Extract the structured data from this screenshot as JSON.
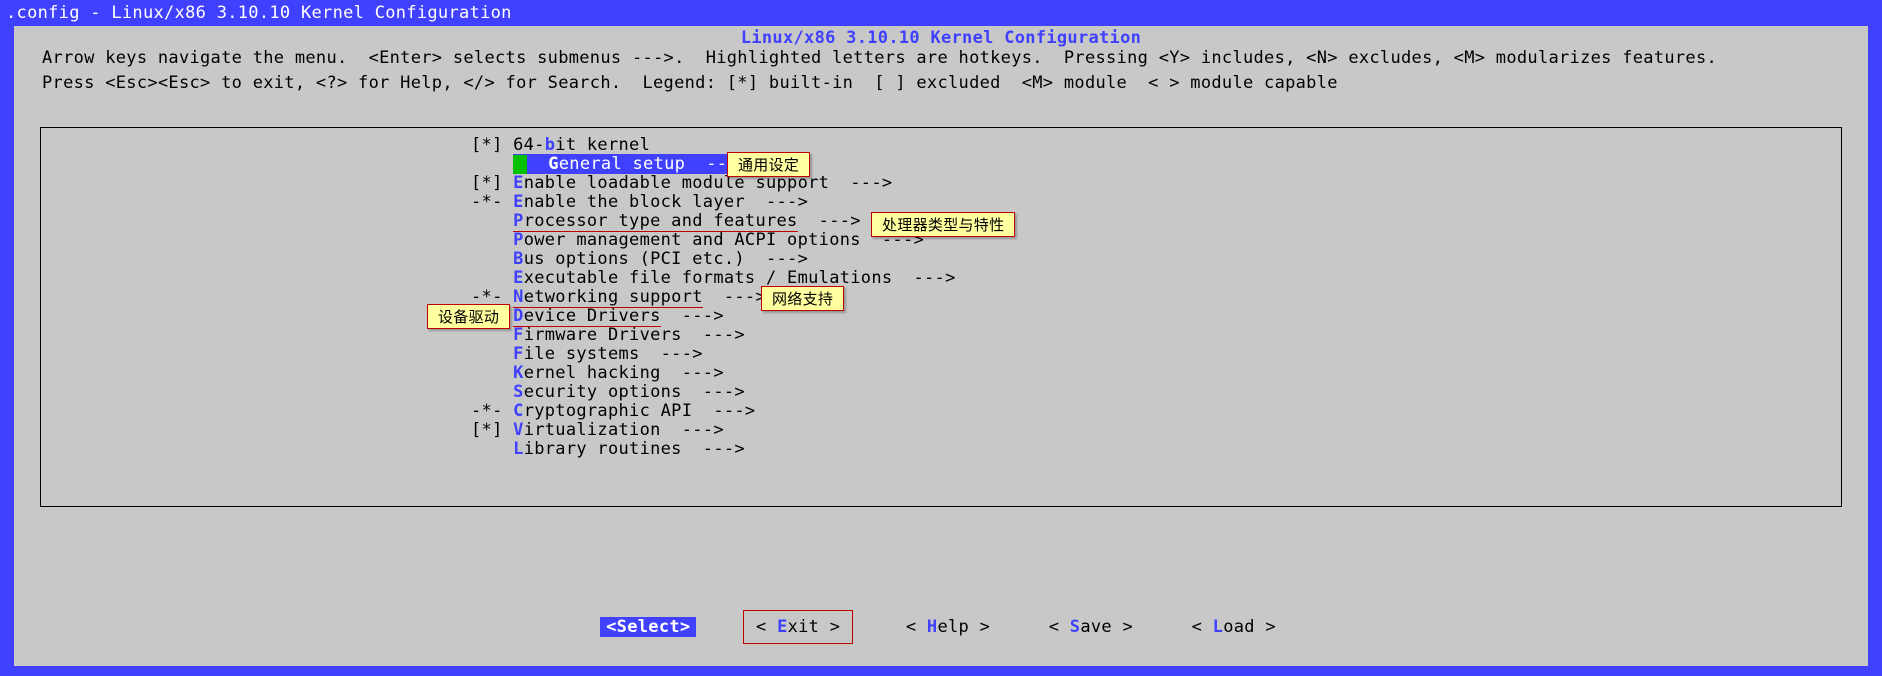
{
  "titlebar": ".config - Linux/x86 3.10.10 Kernel Configuration",
  "dialog_title": "Linux/x86 3.10.10 Kernel Configuration",
  "help_line1": "Arrow keys navigate the menu.  <Enter> selects submenus --->.  Highlighted letters are hotkeys.  Pressing <Y> includes, <N> excludes, <M> modularizes features.",
  "help_line2": "Press <Esc><Esc> to exit, <?> for Help, </> for Search.  Legend: [*] built-in  [ ] excluded  <M> module  < > module capable",
  "menu": {
    "items": [
      {
        "prefix": "[*] ",
        "pre": "64-",
        "hot": "b",
        "post": "it kernel"
      },
      {
        "prefix": "    ",
        "pre": "",
        "hot": "G",
        "post": "eneral setup  --->",
        "selected": true
      },
      {
        "prefix": "[*] ",
        "pre": "",
        "hot": "E",
        "post": "nable loadable module support  --->"
      },
      {
        "prefix": "-*- ",
        "pre": "",
        "hot": "E",
        "post": "nable the block layer  --->"
      },
      {
        "prefix": "    ",
        "pre": "",
        "hot": "P",
        "post": "rocessor type and features",
        "tail": "  --->",
        "underline": true
      },
      {
        "prefix": "    ",
        "pre": "",
        "hot": "P",
        "post": "ower management and ACPI options  --->"
      },
      {
        "prefix": "    ",
        "pre": "",
        "hot": "B",
        "post": "us options (PCI etc.)  --->"
      },
      {
        "prefix": "    ",
        "pre": "",
        "hot": "E",
        "post": "xecutable file formats / Emulations  --->"
      },
      {
        "prefix": "-*- ",
        "pre": "",
        "hot": "N",
        "post": "etworking support",
        "tail": "  --->",
        "underline": true
      },
      {
        "prefix": "    ",
        "pre": "",
        "hot": "D",
        "post": "evice Drivers",
        "tail": "  --->",
        "underline": true
      },
      {
        "prefix": "    ",
        "pre": "",
        "hot": "F",
        "post": "irmware Drivers  --->"
      },
      {
        "prefix": "    ",
        "pre": "",
        "hot": "F",
        "post": "ile systems  --->"
      },
      {
        "prefix": "    ",
        "pre": "",
        "hot": "K",
        "post": "ernel hacking  --->"
      },
      {
        "prefix": "    ",
        "pre": "",
        "hot": "S",
        "post": "ecurity options  --->"
      },
      {
        "prefix": "-*- ",
        "pre": "",
        "hot": "C",
        "post": "ryptographic API  --->"
      },
      {
        "prefix": "[*] ",
        "pre": "",
        "hot": "V",
        "post": "irtualization  --->"
      },
      {
        "prefix": "    ",
        "pre": "",
        "hot": "L",
        "post": "ibrary routines  --->"
      }
    ]
  },
  "annotations": {
    "general": "通用设定",
    "processor": "处理器类型与特性",
    "network": "网络支持",
    "device": "设备驱动"
  },
  "buttons": {
    "select": {
      "pre": "<",
      "hot": "S",
      "post": "elect>"
    },
    "exit": {
      "pre": "< ",
      "hot": "E",
      "post": "xit >"
    },
    "help": {
      "pre": "< ",
      "hot": "H",
      "post": "elp >"
    },
    "save": {
      "pre": "< ",
      "hot": "S",
      "post": "ave >"
    },
    "load": {
      "pre": "< ",
      "hot": "L",
      "post": "oad >"
    }
  }
}
